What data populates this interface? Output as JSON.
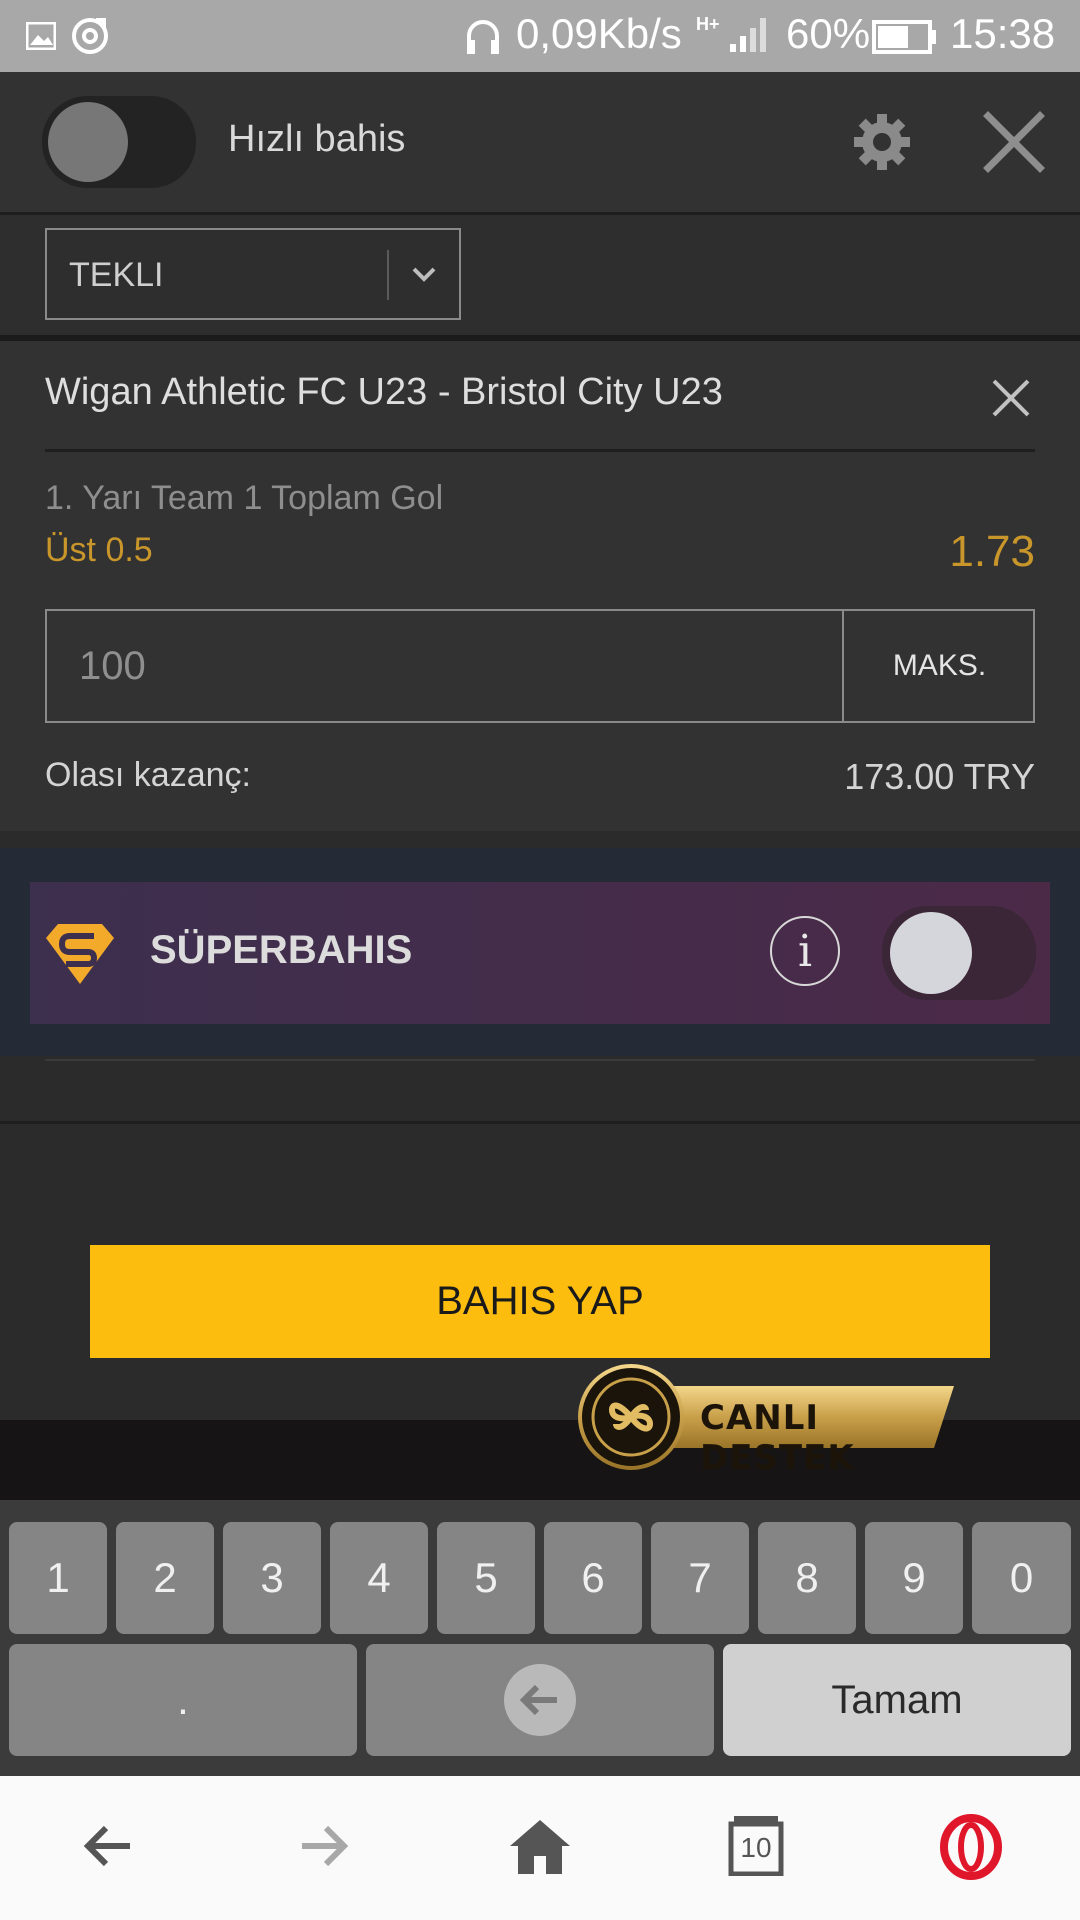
{
  "status_bar": {
    "net_speed": "0,09Kb/s",
    "network_type": "H+",
    "battery_percent": "60%",
    "time": "15:38",
    "icons": [
      "image-icon",
      "sync-icon",
      "headphones-icon",
      "signal-icon",
      "battery-icon"
    ]
  },
  "header": {
    "quick_bet_label": "Hızlı bahis",
    "quick_bet_enabled": false,
    "icons": [
      "gear-icon",
      "close-icon"
    ]
  },
  "bet_type": {
    "selected": "TEKLI"
  },
  "bet": {
    "match": "Wigan Athletic FC U23 - Bristol City U23",
    "market": "1. Yarı Team 1 Toplam Gol",
    "selection": "Üst 0.5",
    "odds": "1.73",
    "stake_value": "100",
    "max_label": "MAKS.",
    "payout_label": "Olası kazanç:",
    "payout_value": "173.00 TRY"
  },
  "superbahis": {
    "label": "SÜPERBAHIS",
    "info_glyph": "i",
    "enabled": false
  },
  "place_bet_label": "BAHIS YAP",
  "support_badge": {
    "label": "CANLI DESTEK"
  },
  "keyboard": {
    "digits": [
      "1",
      "2",
      "3",
      "4",
      "5",
      "6",
      "7",
      "8",
      "9",
      "0"
    ],
    "decimal": ".",
    "done_label": "Tamam"
  },
  "navbar": {
    "tab_count": "10",
    "icons": [
      "back-arrow-icon",
      "forward-arrow-icon",
      "home-icon",
      "tabs-icon",
      "opera-icon"
    ]
  },
  "colors": {
    "accent_yellow": "#fdbd0f",
    "odds_gold": "#c8962a",
    "opera_red": "#e0162b"
  }
}
